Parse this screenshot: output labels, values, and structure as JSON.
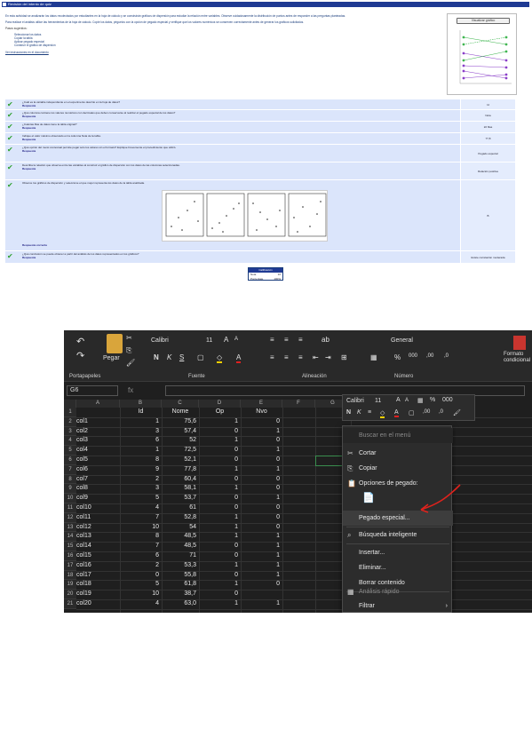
{
  "doc": {
    "title_bar": "Revisión del intento de quiz",
    "mini_chart_button": "Visualizar gráfico",
    "intro_p1": "En esta actividad se analizarán los datos recolectados por estudiantes en la hoja de cálculo y se construirán gráficos de dispersión para estudiar la relación entre variables. Observe cuidadosamente la distribución de puntos antes de responder a las preguntas planteadas.",
    "intro_p2": "Para realizar el análisis utilice las herramientas de la hoja de cálculo. Copie los datos, péguelos con la opción de pegado especial y verifique que los valores numéricos se conserven correctamente antes de generar los gráficos solicitados.",
    "intro_list_title": "Pasos sugeridos:",
    "intro_list": [
      "Seleccionar los datos",
      "Copiar la tabla",
      "Aplicar pegado especial",
      "Construir el gráfico de dispersión"
    ],
    "intro_link": "Ver instrucciones en el documento",
    "score": {
      "header": "Calificación",
      "row1_label": "Nota",
      "row1_value": "10",
      "row2_label": "Porcentaje",
      "row2_value": "100%"
    }
  },
  "questions": [
    {
      "text": "¿Cuál es la variable independiente en el experimento descrito en la hoja de datos?",
      "answer_label": "Respuesta",
      "answer": "Id"
    },
    {
      "text": "¿Qué columna contiene los valores numéricos con decimales que deben conservarse al realizar el pegado especial de los datos?",
      "answer_label": "Respuesta",
      "answer": "Nota"
    },
    {
      "text": "¿Cuántas filas de datos tiene la tabla original?",
      "answer_label": "Respuesta",
      "answer": "22 filas"
    },
    {
      "text": "Indique el valor máximo observado en la columna Nota de la tabla.",
      "answer_label": "Respuesta",
      "answer": "77,8"
    },
    {
      "text": "¿Qué opción del menú contextual permite pegar solo los valores sin el formato? Explique brevemente el procedimiento que utilizó.",
      "answer_label": "Respuesta",
      "answer": "Pegado especial"
    },
    {
      "text": "Describa la relación que observa entre las variables al construir el gráfico de dispersión con los datos de las columnas seleccionadas.",
      "answer_label": "Respuesta",
      "answer": "Relación positiva"
    },
    {
      "text": "Observe los gráficos de dispersión y seleccione el que mejor representa los datos de la tabla analizada.",
      "answer_label": "Respuesta correcta",
      "answer": "B"
    },
    {
      "text": "¿Qué conclusión se puede obtener a partir del análisis de los datos representados en los gráficos?",
      "answer_label": "Respuesta",
      "answer": "Existe correlación moderada"
    }
  ],
  "excel": {
    "ribbon": {
      "font_name": "Calibri",
      "font_size": "11",
      "paste_label": "Pegar",
      "number_format": "General",
      "groups": [
        "Portapapeles",
        "Fuente",
        "Alineación",
        "Número"
      ],
      "right_label": "Formato condicional"
    },
    "namebox": "G6",
    "fx": "fx",
    "columns": [
      "A",
      "B",
      "C",
      "D",
      "E",
      "F",
      "G"
    ],
    "headers": {
      "b": "Id",
      "c": "Nome",
      "d": "Op",
      "e": "Nvo"
    },
    "rows": [
      {
        "n": "1",
        "a": "",
        "b": "Id",
        "c": "Nome",
        "d": "Op",
        "e": "Nvo"
      },
      {
        "n": "2",
        "a": "col1",
        "b": "1",
        "c": "75,6",
        "d": "1",
        "e": "0"
      },
      {
        "n": "3",
        "a": "col2",
        "b": "3",
        "c": "57,4",
        "d": "0",
        "e": "1"
      },
      {
        "n": "4",
        "a": "col3",
        "b": "6",
        "c": "52",
        "d": "1",
        "e": "0"
      },
      {
        "n": "5",
        "a": "col4",
        "b": "1",
        "c": "72,5",
        "d": "0",
        "e": "1"
      },
      {
        "n": "6",
        "a": "col5",
        "b": "8",
        "c": "52,1",
        "d": "0",
        "e": "0"
      },
      {
        "n": "7",
        "a": "col6",
        "b": "9",
        "c": "77,8",
        "d": "1",
        "e": "1"
      },
      {
        "n": "8",
        "a": "col7",
        "b": "2",
        "c": "60,4",
        "d": "0",
        "e": "0"
      },
      {
        "n": "9",
        "a": "col8",
        "b": "3",
        "c": "58,1",
        "d": "1",
        "e": "0"
      },
      {
        "n": "10",
        "a": "col9",
        "b": "5",
        "c": "53,7",
        "d": "0",
        "e": "1"
      },
      {
        "n": "11",
        "a": "col10",
        "b": "4",
        "c": "61",
        "d": "0",
        "e": "0"
      },
      {
        "n": "12",
        "a": "col11",
        "b": "7",
        "c": "52,8",
        "d": "1",
        "e": "0"
      },
      {
        "n": "13",
        "a": "col12",
        "b": "10",
        "c": "54",
        "d": "1",
        "e": "0"
      },
      {
        "n": "14",
        "a": "col13",
        "b": "8",
        "c": "48,5",
        "d": "1",
        "e": "1"
      },
      {
        "n": "15",
        "a": "col14",
        "b": "7",
        "c": "48,5",
        "d": "0",
        "e": "1"
      },
      {
        "n": "16",
        "a": "col15",
        "b": "6",
        "c": "71",
        "d": "0",
        "e": "1"
      },
      {
        "n": "17",
        "a": "col16",
        "b": "2",
        "c": "53,3",
        "d": "1",
        "e": "1"
      },
      {
        "n": "18",
        "a": "col17",
        "b": "0",
        "c": "55,8",
        "d": "0",
        "e": "1"
      },
      {
        "n": "19",
        "a": "col18",
        "b": "5",
        "c": "61,8",
        "d": "1",
        "e": "0"
      },
      {
        "n": "20",
        "a": "col19",
        "b": "10",
        "c": "38,7",
        "d": "0",
        "e": ""
      },
      {
        "n": "21",
        "a": "col20",
        "b": "4",
        "c": "63,0",
        "d": "1",
        "e": "1"
      }
    ],
    "mini_toolbar_font": "Calibri",
    "mini_toolbar_size": "11",
    "context_menu": [
      {
        "label": "Buscar en el menú",
        "icon": "",
        "dim": true
      },
      {
        "label": "Cortar",
        "icon": "✂"
      },
      {
        "label": "Copiar",
        "icon": "⎘"
      },
      {
        "label": "Opciones de pegado:",
        "icon": "📋"
      },
      {
        "label": "",
        "icon": "📄"
      },
      {
        "label": "Pegado especial...",
        "icon": "",
        "highlight": true
      },
      {
        "label": "Búsqueda inteligente",
        "icon": "🔍"
      },
      {
        "label": "Insertar...",
        "icon": ""
      },
      {
        "label": "Eliminar...",
        "icon": ""
      },
      {
        "label": "Borrar contenido",
        "icon": ""
      },
      {
        "label": "Análisis rápido",
        "icon": "▦",
        "dim": true
      },
      {
        "label": "Filtrar",
        "icon": "",
        "arrow": true
      }
    ],
    "accent_green": "#2ea02e",
    "arrow_color": "#e0221c"
  }
}
